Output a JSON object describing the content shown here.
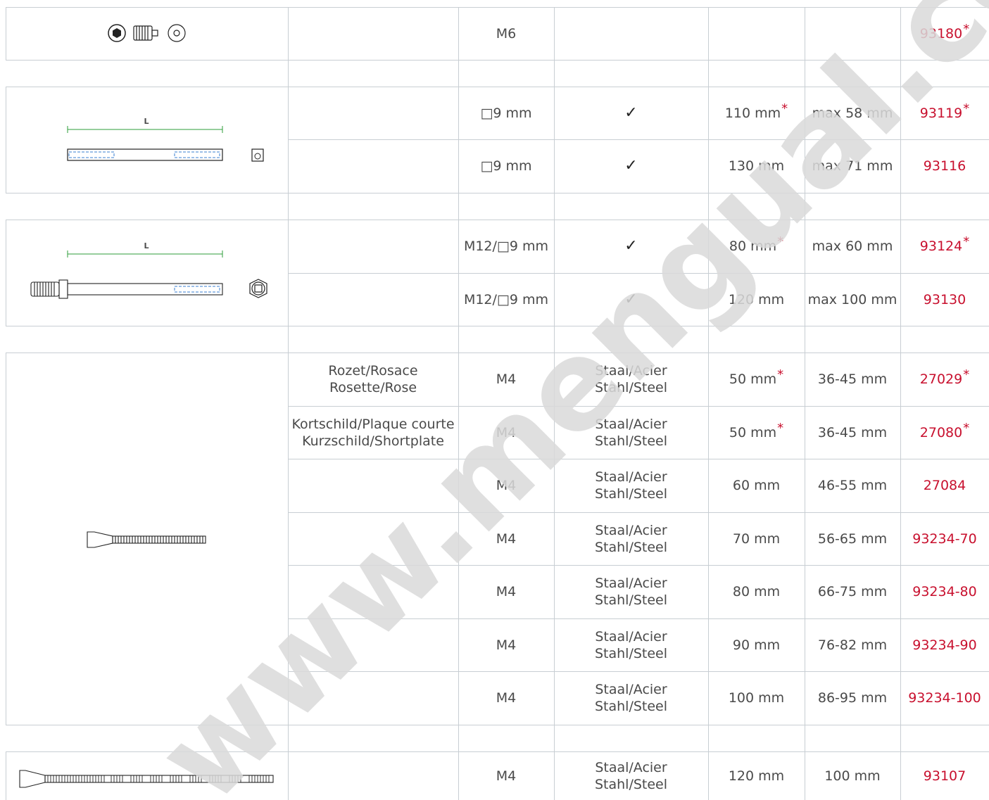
{
  "groups": [
    {
      "rows": [
        {
          "desc": "",
          "thread": "M6",
          "mark": "",
          "length": "",
          "length_star": false,
          "range": "",
          "code": "93180",
          "code_star": true
        }
      ]
    },
    {
      "image_label": "L",
      "rows": [
        {
          "desc": "",
          "thread": "□9 mm",
          "mark": "✓",
          "length": "110 mm",
          "length_star": true,
          "range": "max 58 mm",
          "code": "93119",
          "code_star": true
        },
        {
          "desc": "",
          "thread": "□9 mm",
          "mark": "✓",
          "length": "130 mm",
          "length_star": false,
          "range": "max 71 mm",
          "code": "93116",
          "code_star": false
        }
      ]
    },
    {
      "image_label": "L",
      "rows": [
        {
          "desc": "",
          "thread": "M12/□9 mm",
          "mark": "✓",
          "length": "80 mm",
          "length_star": true,
          "range": "max 60 mm",
          "code": "93124",
          "code_star": true
        },
        {
          "desc": "",
          "thread": "M12/□9 mm",
          "mark": "✓",
          "length": "120 mm",
          "length_star": false,
          "range": "max 100 mm",
          "code": "93130",
          "code_star": false
        }
      ]
    },
    {
      "rows": [
        {
          "desc1": "Rozet/Rosace",
          "desc2": "Rosette/Rose",
          "thread": "M4",
          "mat1": "Staal/Acier",
          "mat2": "Stahl/Steel",
          "length": "50 mm",
          "length_star": true,
          "range": "36-45 mm",
          "code": "27029",
          "code_star": true
        },
        {
          "desc1": "Kortschild/Plaque courte",
          "desc2": "Kurzschild/Shortplate",
          "thread": "M4",
          "mat1": "Staal/Acier",
          "mat2": "Stahl/Steel",
          "length": "50 mm",
          "length_star": true,
          "range": "36-45 mm",
          "code": "27080",
          "code_star": true
        },
        {
          "desc1": "",
          "desc2": "",
          "thread": "M4",
          "mat1": "Staal/Acier",
          "mat2": "Stahl/Steel",
          "length": "60 mm",
          "length_star": false,
          "range": "46-55 mm",
          "code": "27084",
          "code_star": false
        },
        {
          "desc1": "",
          "desc2": "",
          "thread": "M4",
          "mat1": "Staal/Acier",
          "mat2": "Stahl/Steel",
          "length": "70 mm",
          "length_star": false,
          "range": "56-65 mm",
          "code": "93234-70",
          "code_star": false
        },
        {
          "desc1": "",
          "desc2": "",
          "thread": "M4",
          "mat1": "Staal/Acier",
          "mat2": "Stahl/Steel",
          "length": "80 mm",
          "length_star": false,
          "range": "66-75 mm",
          "code": "93234-80",
          "code_star": false
        },
        {
          "desc1": "",
          "desc2": "",
          "thread": "M4",
          "mat1": "Staal/Acier",
          "mat2": "Stahl/Steel",
          "length": "90 mm",
          "length_star": false,
          "range": "76-82 mm",
          "code": "93234-90",
          "code_star": false
        },
        {
          "desc1": "",
          "desc2": "",
          "thread": "M4",
          "mat1": "Staal/Acier",
          "mat2": "Stahl/Steel",
          "length": "100 mm",
          "length_star": false,
          "range": "86-95 mm",
          "code": "93234-100",
          "code_star": false
        }
      ]
    },
    {
      "rows": [
        {
          "desc1": "",
          "desc2": "",
          "thread": "M4",
          "mat1": "Staal/Acier",
          "mat2": "Stahl/Steel",
          "length": "120 mm",
          "length_star": false,
          "range": "100 mm",
          "code": "93107",
          "code_star": false
        }
      ]
    }
  ],
  "star_symbol": "*",
  "watermark": "www.mengual.com",
  "colors": {
    "code": "#c8102e",
    "grid": "#c8ced3",
    "dimension_line": "#2e9e3a",
    "hidden_thread": "#3a7fd0",
    "watermark": "#d9d9d9"
  }
}
